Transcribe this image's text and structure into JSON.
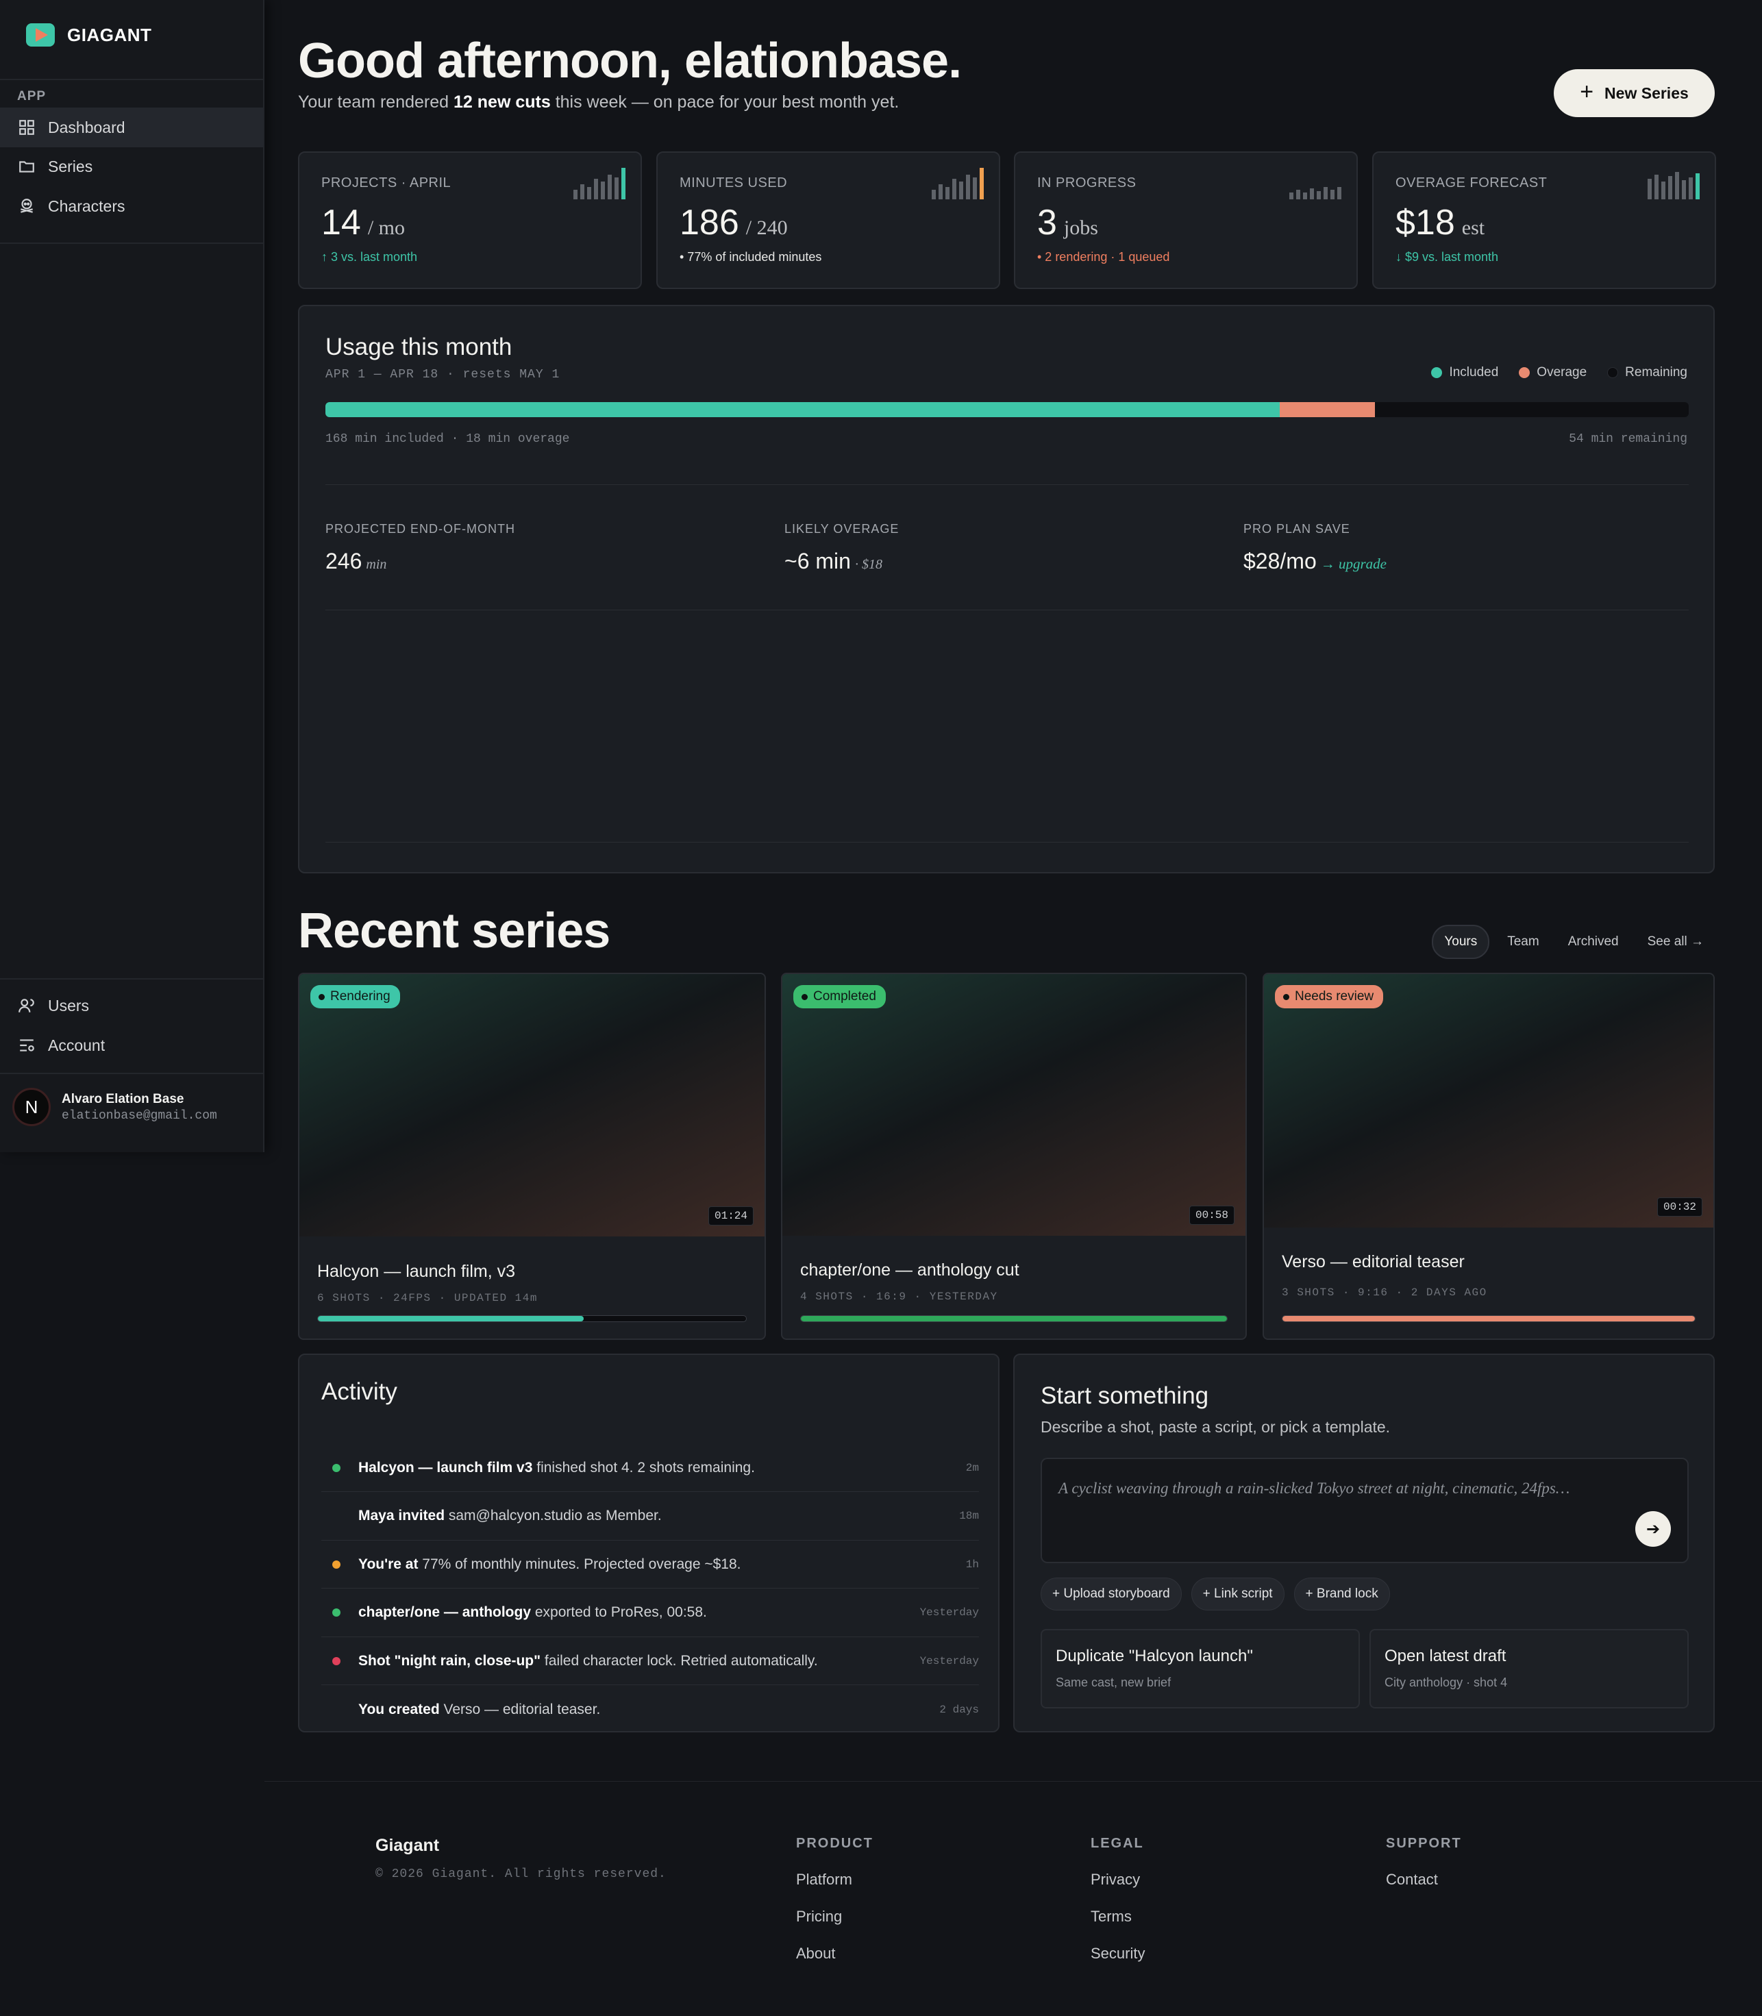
{
  "brand": {
    "name": "GIAGANT"
  },
  "sidebar": {
    "section": "APP",
    "items": [
      {
        "label": "Dashboard",
        "icon": "grid-icon"
      },
      {
        "label": "Series",
        "icon": "folder-icon"
      },
      {
        "label": "Characters",
        "icon": "skull-icon"
      }
    ],
    "bottom_items": [
      {
        "label": "Users",
        "icon": "user-icon"
      },
      {
        "label": "Account",
        "icon": "settings-list-icon"
      }
    ],
    "user": {
      "initial": "N",
      "name": "Alvaro Elation Base",
      "email": "elationbase@gmail.com"
    }
  },
  "header": {
    "greeting": "Good afternoon, elationbase.",
    "sub_pre": "Your team rendered ",
    "sub_bold": "12 new cuts",
    "sub_post": " this week — on pace for your best month yet.",
    "new_button": "New Series"
  },
  "stats": [
    {
      "label": "PROJECTS · APRIL",
      "value": "14",
      "unit": "/ mo",
      "note": "↑ 3 vs. last month",
      "note_color": "#3ec6a8",
      "spark": [
        14,
        22,
        18,
        30,
        26,
        36,
        32,
        46
      ],
      "accent": "#3ec6a8"
    },
    {
      "label": "MINUTES USED",
      "value": "186",
      "unit": "/ 240",
      "note": "• 77% of included minutes",
      "note_color": "#e8e8e6",
      "spark": [
        14,
        22,
        18,
        30,
        26,
        36,
        32,
        46
      ],
      "accent": "#f0a050"
    },
    {
      "label": "IN PROGRESS",
      "value": "3",
      "unit": "jobs",
      "note": "• 2 rendering · 1 queued",
      "note_color": "#f07f60",
      "spark": [
        10,
        14,
        10,
        16,
        12,
        18,
        14,
        18
      ],
      "accent": "#5f6369"
    },
    {
      "label": "OVERAGE FORECAST",
      "value": "$18",
      "unit": "est",
      "note": "↓ $9 vs. last month",
      "note_color": "#3ec6a8",
      "spark": [
        30,
        36,
        26,
        34,
        40,
        28,
        32,
        38
      ],
      "accent": "#3ec6a8"
    }
  ],
  "usage": {
    "title": "Usage this month",
    "period": "APR 1 — APR 18  · resets MAY 1",
    "legend": [
      {
        "label": "Included",
        "color": "#3ec6a8"
      },
      {
        "label": "Overage",
        "color": "#e88a70"
      },
      {
        "label": "Remaining",
        "color": "#0c0d10"
      }
    ],
    "included_fraction": 0.7,
    "overage_fraction": 0.07,
    "bar_left": "168 min included · 18 min overage",
    "bar_right": "54 min remaining",
    "projections": [
      {
        "label": "PROJECTED END-OF-MONTH",
        "value": "246",
        "suffix": "min",
        "extra": ""
      },
      {
        "label": "LIKELY OVERAGE",
        "value": "~6 min",
        "suffix": "· $18",
        "extra": ""
      },
      {
        "label": "PRO PLAN SAVE",
        "value": "$28/mo",
        "suffix": "",
        "extra": "→ upgrade"
      }
    ]
  },
  "recent": {
    "title": "Recent series",
    "tabs": [
      "Yours",
      "Team",
      "Archived",
      "See all →"
    ],
    "cards": [
      {
        "status": "Rendering",
        "status_color": "#3ec6a8",
        "duration": "01:24",
        "title": "Halcyon — launch film, v3",
        "meta": "6 SHOTS  · 24FPS  · UPDATED 14m",
        "progress": 0.62,
        "bar_color": "#3ec6a8"
      },
      {
        "status": "Completed",
        "status_color": "#3bbd6e",
        "duration": "00:58",
        "title": "chapter/one — anthology cut",
        "meta": "4 SHOTS  · 16:9  · YESTERDAY",
        "progress": 1.0,
        "bar_color": "#2ea85a"
      },
      {
        "status": "Needs review",
        "status_color": "#e88a70",
        "duration": "00:32",
        "title": "Verso — editorial teaser",
        "meta": "3 SHOTS  · 9:16  · 2 DAYS AGO",
        "progress": 1.0,
        "bar_color": "#e88a70"
      }
    ]
  },
  "activity": {
    "title": "Activity",
    "items": [
      {
        "dot": "#3bbd6e",
        "bold": "Halcyon — launch film v3",
        "text": " finished shot 4. 2 shots remaining.",
        "time": "2m"
      },
      {
        "dot": "",
        "bold": "Maya invited",
        "text": " sam@halcyon.studio as Member.",
        "time": "18m"
      },
      {
        "dot": "#f0a030",
        "bold": "You're at",
        "text": " 77% of monthly minutes. Projected overage ~$18.",
        "time": "1h"
      },
      {
        "dot": "#3bbd6e",
        "bold": "chapter/one — anthology",
        "text": " exported to ProRes, 00:58.",
        "time": "Yesterday"
      },
      {
        "dot": "#e0405a",
        "bold": "Shot \"night rain, close-up\"",
        "text": " failed character lock. Retried automatically.",
        "time": "Yesterday"
      },
      {
        "dot": "",
        "bold": "You created",
        "text": " Verso — editorial teaser.",
        "time": "2 days"
      }
    ]
  },
  "start": {
    "title": "Start something",
    "subtitle": "Describe a shot, paste a script, or pick a template.",
    "placeholder": "A cyclist weaving through a rain-slicked Tokyo street at night, cinematic, 24fps…",
    "chips": [
      "+ Upload storyboard",
      "+ Link script",
      "+ Brand lock"
    ],
    "templates": [
      {
        "title": "Duplicate \"Halcyon launch\"",
        "sub": "Same cast, new brief"
      },
      {
        "title": "Open latest draft",
        "sub": "City anthology · shot 4"
      }
    ]
  },
  "footer": {
    "brand": "Giagant",
    "copyright": "© 2026 Giagant. All rights reserved.",
    "columns": [
      {
        "head": "PRODUCT",
        "links": [
          "Platform",
          "Pricing",
          "About"
        ]
      },
      {
        "head": "LEGAL",
        "links": [
          "Privacy",
          "Terms",
          "Security"
        ]
      },
      {
        "head": "SUPPORT",
        "links": [
          "Contact"
        ]
      }
    ]
  }
}
